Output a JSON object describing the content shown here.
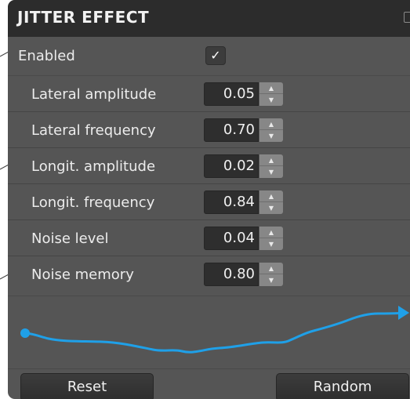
{
  "panel": {
    "title": "JITTER EFFECT",
    "enabled": {
      "label": "Enabled",
      "checked": true,
      "check_glyph": "✓"
    }
  },
  "params": [
    {
      "label": "Lateral amplitude",
      "value": "0.05"
    },
    {
      "label": "Lateral frequency",
      "value": "0.70"
    },
    {
      "label": "Longit. amplitude",
      "value": "0.02"
    },
    {
      "label": "Longit. frequency",
      "value": "0.84"
    },
    {
      "label": "Noise level",
      "value": "0.04"
    },
    {
      "label": "Noise memory",
      "value": "0.80"
    }
  ],
  "buttons": {
    "reset": "Reset",
    "random": "Random"
  },
  "colors": {
    "panel_bg": "#555555",
    "header_bg": "#2c2c2c",
    "curve": "#1fa0e8"
  },
  "icons": {
    "collapse": "collapse-icon",
    "checkbox": "checkmark-icon",
    "spinner_up": "spin-up-icon",
    "spinner_down": "spin-down-icon",
    "curve_start": "dot-icon",
    "curve_end": "arrow-icon"
  }
}
